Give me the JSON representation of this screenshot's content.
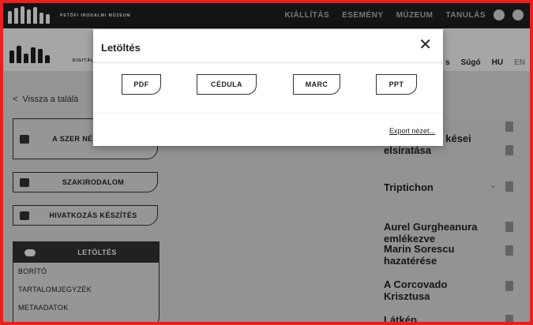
{
  "header": {
    "logo_text": "PETŐFI IRODALMI MÚZEUM",
    "nav": [
      "KIÁLLÍTÁS",
      "ESEMÉNY",
      "MÚZEUM",
      "TANULÁS"
    ],
    "icons": [
      "user-icon",
      "eye-icon"
    ]
  },
  "subheader": {
    "logo_text": "DIGITÁLIS",
    "items": [
      "s",
      "Súgó",
      "HU",
      "EN"
    ]
  },
  "back": {
    "label": "Vissza a találá"
  },
  "sidebar": {
    "items": [
      {
        "label": "A SZER NÉVTEREBEN",
        "icon": "person-card-icon"
      },
      {
        "label": "SZAKIRODALOM",
        "icon": "book-icon"
      },
      {
        "label": "HIVATKOZÁS KÉSZÍTÉS",
        "icon": "cloud-download-icon"
      }
    ],
    "download": {
      "label": "LETÖLTÉS",
      "icon": "cloud-download-icon",
      "items": [
        "BORÍTÓ",
        "TARTALOMJEGYZÉK",
        "METAADATOK"
      ]
    }
  },
  "results": [
    "Bajor Andor kései elsiratása",
    "Triptichon",
    "Aurel Gurgheanura emlékezve",
    "Marin Sorescu hazatérése",
    "A Corcovado Krisztusa",
    "Látkép"
  ],
  "modal": {
    "title": "Letöltés",
    "close": "✕",
    "formats": [
      "PDF",
      "CÉDULA",
      "MARC",
      "PPT"
    ],
    "export_link": "Export nézet..."
  },
  "colors": {
    "border": "#e8201f",
    "dark": "#1f1f1f",
    "panel": "#e6e6e6"
  }
}
